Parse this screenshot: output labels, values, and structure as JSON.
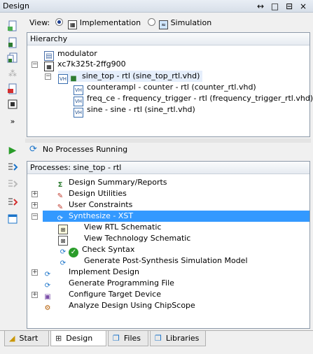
{
  "window": {
    "title": "Design",
    "controls": "↔ □ ⊟ ×"
  },
  "view_bar": {
    "label": "View:",
    "option1": "Implementation",
    "option2": "Simulation"
  },
  "hierarchy": {
    "header": "Hierarchy",
    "items": [
      "modulator",
      "xc7k325t-2ffg900",
      "sine_top - rtl (sine_top_rtl.vhd)",
      "counterampl - counter - rtl (counter_rtl.vhd)",
      "freq_ce - frequency_trigger - rtl (frequency_trigger_rtl.vhd)",
      "sine - sine - rtl (sine_rtl.vhd)"
    ]
  },
  "status": {
    "text": "No Processes Running"
  },
  "processes": {
    "header": "Processes: sine_top - rtl",
    "items": [
      "Design Summary/Reports",
      "Design Utilities",
      "User Constraints",
      "Synthesize - XST",
      "View RTL Schematic",
      "View Technology Schematic",
      "Check Syntax",
      "Generate Post-Synthesis Simulation Model",
      "Implement Design",
      "Generate Programming File",
      "Configure Target Device",
      "Analyze Design Using ChipScope"
    ]
  },
  "tabs": [
    "Start",
    "Design",
    "Files",
    "Libraries"
  ],
  "colors": {
    "selection": "#3399ff",
    "status_green": "#2a9d2a",
    "accent_blue": "#1a73c9"
  }
}
